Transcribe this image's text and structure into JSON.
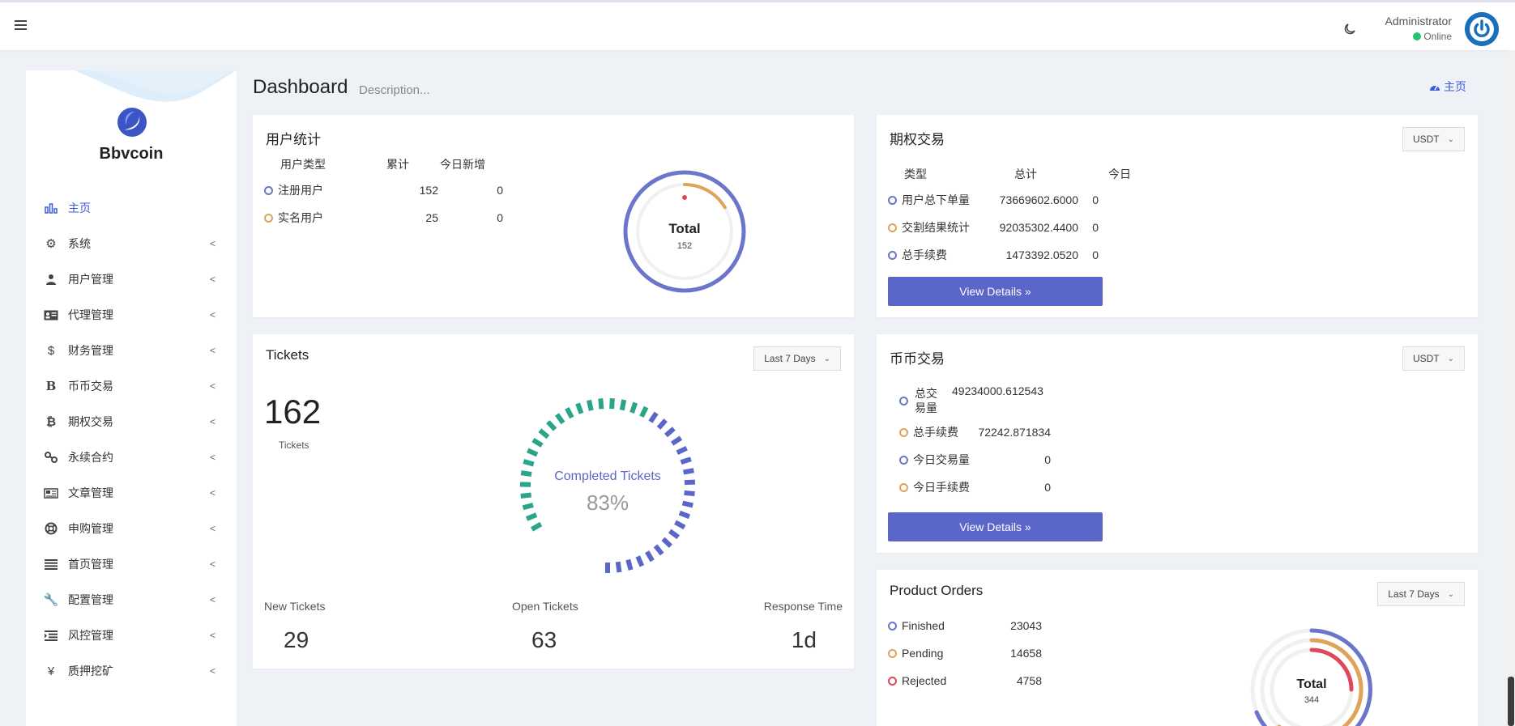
{
  "header": {
    "user_name": "Administrator",
    "user_status": "Online"
  },
  "sidebar": {
    "brand": "Bbvcoin",
    "items": [
      {
        "label": "主页",
        "icon": "bar-chart-icon",
        "active": true
      },
      {
        "label": "系统",
        "icon": "gear-icon"
      },
      {
        "label": "用户管理",
        "icon": "user-icon"
      },
      {
        "label": "代理管理",
        "icon": "id-card-icon"
      },
      {
        "label": "财务管理",
        "icon": "dollar-icon"
      },
      {
        "label": "币币交易",
        "icon": "bitcoin-b-icon"
      },
      {
        "label": "期权交易",
        "icon": "bitcoin-icon"
      },
      {
        "label": "永续合约",
        "icon": "link-icon"
      },
      {
        "label": "文章管理",
        "icon": "newspaper-icon"
      },
      {
        "label": "申购管理",
        "icon": "lifebuoy-icon"
      },
      {
        "label": "首页管理",
        "icon": "list-icon"
      },
      {
        "label": "配置管理",
        "icon": "wrench-icon"
      },
      {
        "label": "风控管理",
        "icon": "indent-icon"
      },
      {
        "label": "质押挖矿",
        "icon": "yen-icon"
      }
    ]
  },
  "page": {
    "title": "Dashboard",
    "description": "Description...",
    "home_link": "主页"
  },
  "user_stats": {
    "title": "用户统计",
    "headers": [
      "用户类型",
      "累计",
      "今日新增"
    ],
    "rows": [
      {
        "type": "注册用户",
        "total": "152",
        "today": "0"
      },
      {
        "type": "实名用户",
        "total": "25",
        "today": "0"
      }
    ],
    "ring_label": "Total",
    "ring_value": "152",
    "ring_fraction": 0.164
  },
  "options_trading": {
    "title": "期权交易",
    "currency": "USDT",
    "headers": [
      "类型",
      "总计",
      "今日"
    ],
    "rows": [
      {
        "type": "用户总下单量",
        "total": "73669602.6000",
        "today": "0"
      },
      {
        "type": "交割结果统计",
        "total": "92035302.4400",
        "today": "0"
      },
      {
        "type": "总手续费",
        "total": "1473392.0520",
        "today": "0"
      }
    ],
    "button": "View Details »"
  },
  "tickets": {
    "title": "Tickets",
    "period": "Last 7 Days",
    "count": "162",
    "count_label": "Tickets",
    "gauge_label": "Completed Tickets",
    "gauge_value": "83%",
    "gauge_percent": 83,
    "stats": [
      {
        "label": "New Tickets",
        "value": "29"
      },
      {
        "label": "Open Tickets",
        "value": "63"
      },
      {
        "label": "Response Time",
        "value": "1d"
      }
    ]
  },
  "coin_trading": {
    "title": "币币交易",
    "currency": "USDT",
    "rows": [
      {
        "label": "总交易量",
        "value": "49234000.612543"
      },
      {
        "label": "总手续费",
        "value": "72242.871834"
      },
      {
        "label": "今日交易量",
        "value": "0"
      },
      {
        "label": "今日手续费",
        "value": "0"
      }
    ],
    "button": "View Details »"
  },
  "product_orders": {
    "title": "Product Orders",
    "period": "Last 7 Days",
    "rows": [
      {
        "label": "Finished",
        "value": "23043"
      },
      {
        "label": "Pending",
        "value": "14658"
      },
      {
        "label": "Rejected",
        "value": "4758"
      }
    ],
    "ring_label": "Total",
    "ring_value": "344"
  },
  "colors": {
    "primary": "#5b67c8",
    "accent_blue": "#3b5bdb",
    "ring_blue": "#6b75c9",
    "ring_orange": "#e0a35a",
    "ring_red": "#e0475b",
    "ring_green": "#2ba58a",
    "online": "#27c46a"
  }
}
